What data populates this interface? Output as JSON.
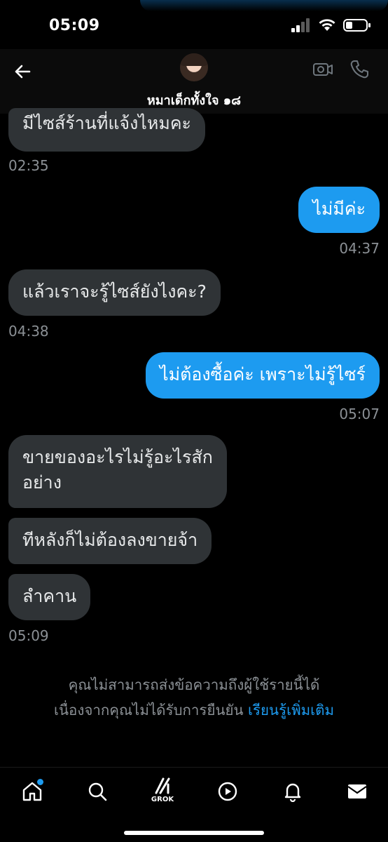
{
  "status": {
    "time": "05:09"
  },
  "header": {
    "contact_name": "หมาเด็กทั้งใจ ๑๘"
  },
  "messages": [
    {
      "side": "in",
      "text": "มีไซส์ร้านที่แจ้งไหมคะ",
      "time": "02:35"
    },
    {
      "side": "out",
      "text": "ไม่มีค่ะ",
      "time": "04:37"
    },
    {
      "side": "in",
      "text": "แล้วเราจะรู้ไซส์ยังไงคะ?",
      "time": "04:38"
    },
    {
      "side": "out",
      "text": "ไม่ต้องซื้อค่ะ เพราะไม่รู้ไซร์",
      "time": "05:07"
    },
    {
      "side": "in",
      "text_line1": "ขายของอะไรไม่รู้อะไรสัก",
      "text_line2": "อย่าง"
    },
    {
      "side": "in",
      "text": "ทีหลังก็ไม่ต้องลงขายจ้า"
    },
    {
      "side": "in",
      "text": "ลำคาน",
      "time": "05:09"
    }
  ],
  "notice": {
    "line1": "คุณไม่สามารถส่งข้อความถึงผู้ใช้รายนี้ได้",
    "line2": "เนื่องจากคุณไม่ได้รับการยืนยัน",
    "link": "เรียนรู้เพิ่มเติม"
  },
  "nav": {
    "grok_label": "GROK",
    "items": [
      "home-icon",
      "search-icon",
      "grok-icon",
      "play-icon",
      "bell-icon",
      "mail-icon"
    ]
  },
  "colors": {
    "accent": "#1d9bf0",
    "incoming_bubble": "#2f3336",
    "timestamp": "#8b9095"
  }
}
